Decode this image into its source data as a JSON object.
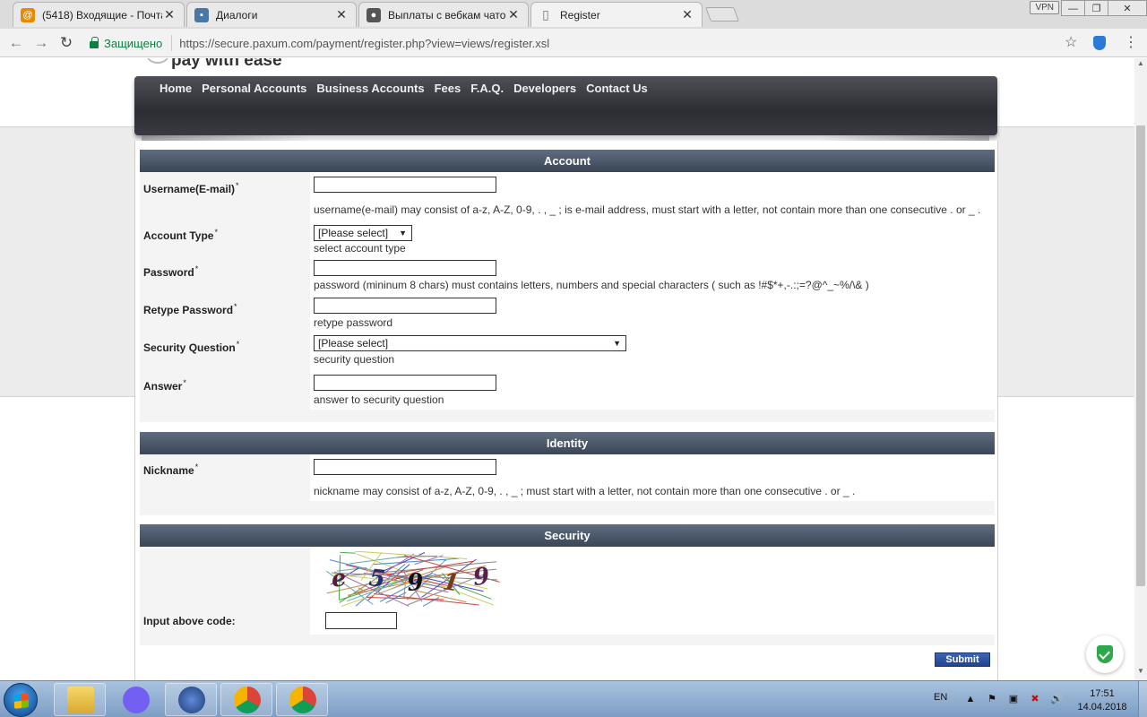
{
  "browser": {
    "tabs": [
      {
        "title": "(5418) Входящие - Почта",
        "close": "✕",
        "favicon_color": "#e68a00",
        "favicon_glyph": "@"
      },
      {
        "title": "Диалоги",
        "close": "✕",
        "favicon_color": "#4a76a8",
        "favicon_glyph": "▪"
      },
      {
        "title": "Выплаты с вебкам чатов",
        "close": "✕",
        "favicon_color": "#555555",
        "favicon_glyph": "●"
      },
      {
        "title": "Register",
        "close": "✕",
        "favicon_color": "#ffffff",
        "favicon_glyph": "▯"
      }
    ],
    "vpn_label": "VPN",
    "window_controls": {
      "minimize": "—",
      "restore": "❐",
      "close": "✕"
    },
    "nav": {
      "back": "←",
      "forward": "→",
      "reload": "↻"
    },
    "secure_label": "Защищено",
    "url": "https://secure.paxum.com/payment/register.php?view=views/register.xsl",
    "bookmark_icon": "☆",
    "menu_icon": "⋮"
  },
  "site": {
    "tagline": "pay with ease",
    "nav_links": [
      "Home",
      "Personal Accounts",
      "Business Accounts",
      "Fees",
      "F.A.Q.",
      "Developers",
      "Contact Us"
    ]
  },
  "form": {
    "required_mark": "*",
    "account": {
      "header": "Account",
      "username_label": "Username(E-mail)",
      "username_hint": "username(e-mail) may consist of a-z, A-Z, 0-9, . , _ ; is e-mail address, must start with a letter, not contain more than one consecutive . or _ .",
      "account_type_label": "Account Type",
      "account_type_value": "[Please select]",
      "account_type_hint": "select account type",
      "password_label": "Password",
      "password_hint": "password (mininum 8 chars) must contains letters, numbers and special characters ( such as !#$*+,-.:;=?@^_~%/\\& )",
      "retype_label": "Retype Password",
      "retype_hint": "retype password",
      "question_label": "Security Question",
      "question_value": "[Please select]",
      "question_hint": "security question",
      "answer_label": "Answer",
      "answer_hint": "answer to security question"
    },
    "identity": {
      "header": "Identity",
      "nickname_label": "Nickname",
      "nickname_hint": "nickname may consist of a-z, A-Z, 0-9, . , _ ; must start with a letter, not contain more than one consecutive . or _ ."
    },
    "security": {
      "header": "Security",
      "captcha_chars": [
        "e",
        "5",
        "9",
        "1",
        "9"
      ],
      "captcha_colors": [
        "#5a1e2e",
        "#1e2f6a",
        "#111111",
        "#7a3a1a",
        "#5a1e4e"
      ],
      "code_label": "Input above code:"
    },
    "submit_label": "Submit"
  },
  "taskbar": {
    "lang": "EN",
    "tray_icons": [
      "▲",
      "⚑",
      "▣",
      "✖",
      "🔊"
    ],
    "time": "17:51",
    "date": "14.04.2018"
  }
}
